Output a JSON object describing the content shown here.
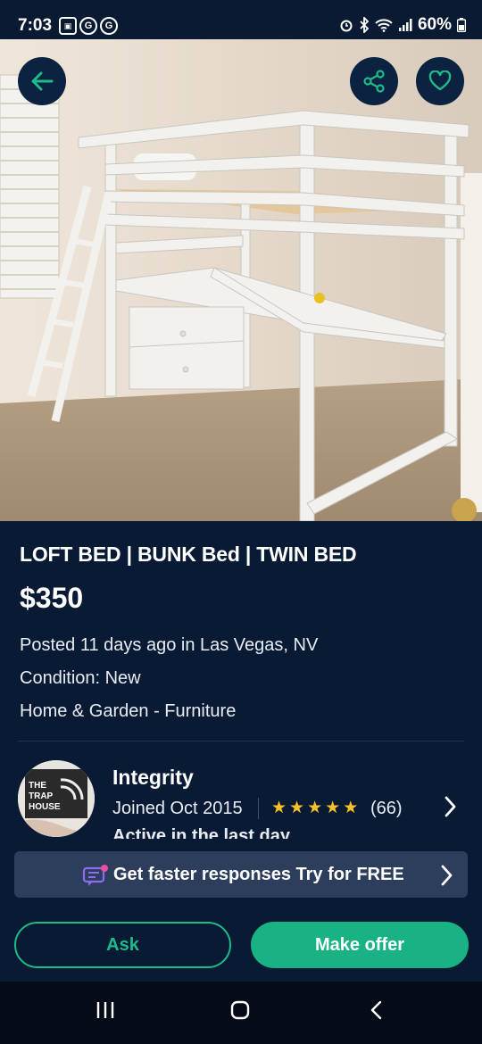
{
  "status_bar": {
    "time": "7:03",
    "battery": "60%",
    "icons": [
      "message-icon",
      "g-icon",
      "g-icon",
      "alarm-icon",
      "bluetooth-icon",
      "wifi-icon",
      "signal-icon",
      "battery-icon"
    ]
  },
  "listing": {
    "title": "LOFT BED | BUNK Bed | TWIN BED",
    "price": "$350",
    "posted": "Posted 11 days ago in Las Vegas, NV",
    "condition": "Condition: New",
    "category": "Home & Garden - Furniture"
  },
  "seller": {
    "name": "Integrity",
    "joined": "Joined  Oct 2015",
    "rating_stars": 5,
    "rating_count": "(66)",
    "activity": "Active in the last day",
    "avatar_lines": [
      "THE",
      "TRAP",
      "HOUSE"
    ]
  },
  "promo": {
    "text": "Get faster responses Try for FREE"
  },
  "actions": {
    "ask": "Ask",
    "offer": "Make offer"
  },
  "colors": {
    "background": "#091a35",
    "accent": "#18b283",
    "star": "#f6c12b",
    "promo_bg": "#2d3e5c"
  }
}
